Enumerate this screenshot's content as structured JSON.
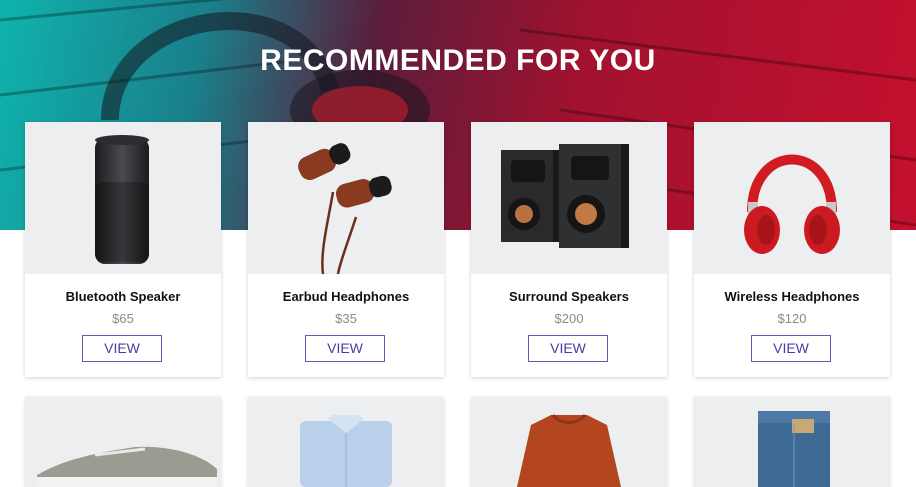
{
  "header": {
    "title": "RECOMMENDED FOR YOU"
  },
  "products": [
    {
      "name": "Bluetooth Speaker",
      "price": "$65",
      "cta": "VIEW"
    },
    {
      "name": "Earbud Headphones",
      "price": "$35",
      "cta": "VIEW"
    },
    {
      "name": "Surround Speakers",
      "price": "$200",
      "cta": "VIEW"
    },
    {
      "name": "Wireless Headphones",
      "price": "$120",
      "cta": "VIEW"
    }
  ],
  "second_row": [
    "sneaker-image",
    "shirt-image",
    "sweater-image",
    "jeans-image"
  ],
  "colors": {
    "accent": "#4b3aa0",
    "hero_left": "#0fb3ad",
    "hero_right": "#c4102e"
  }
}
